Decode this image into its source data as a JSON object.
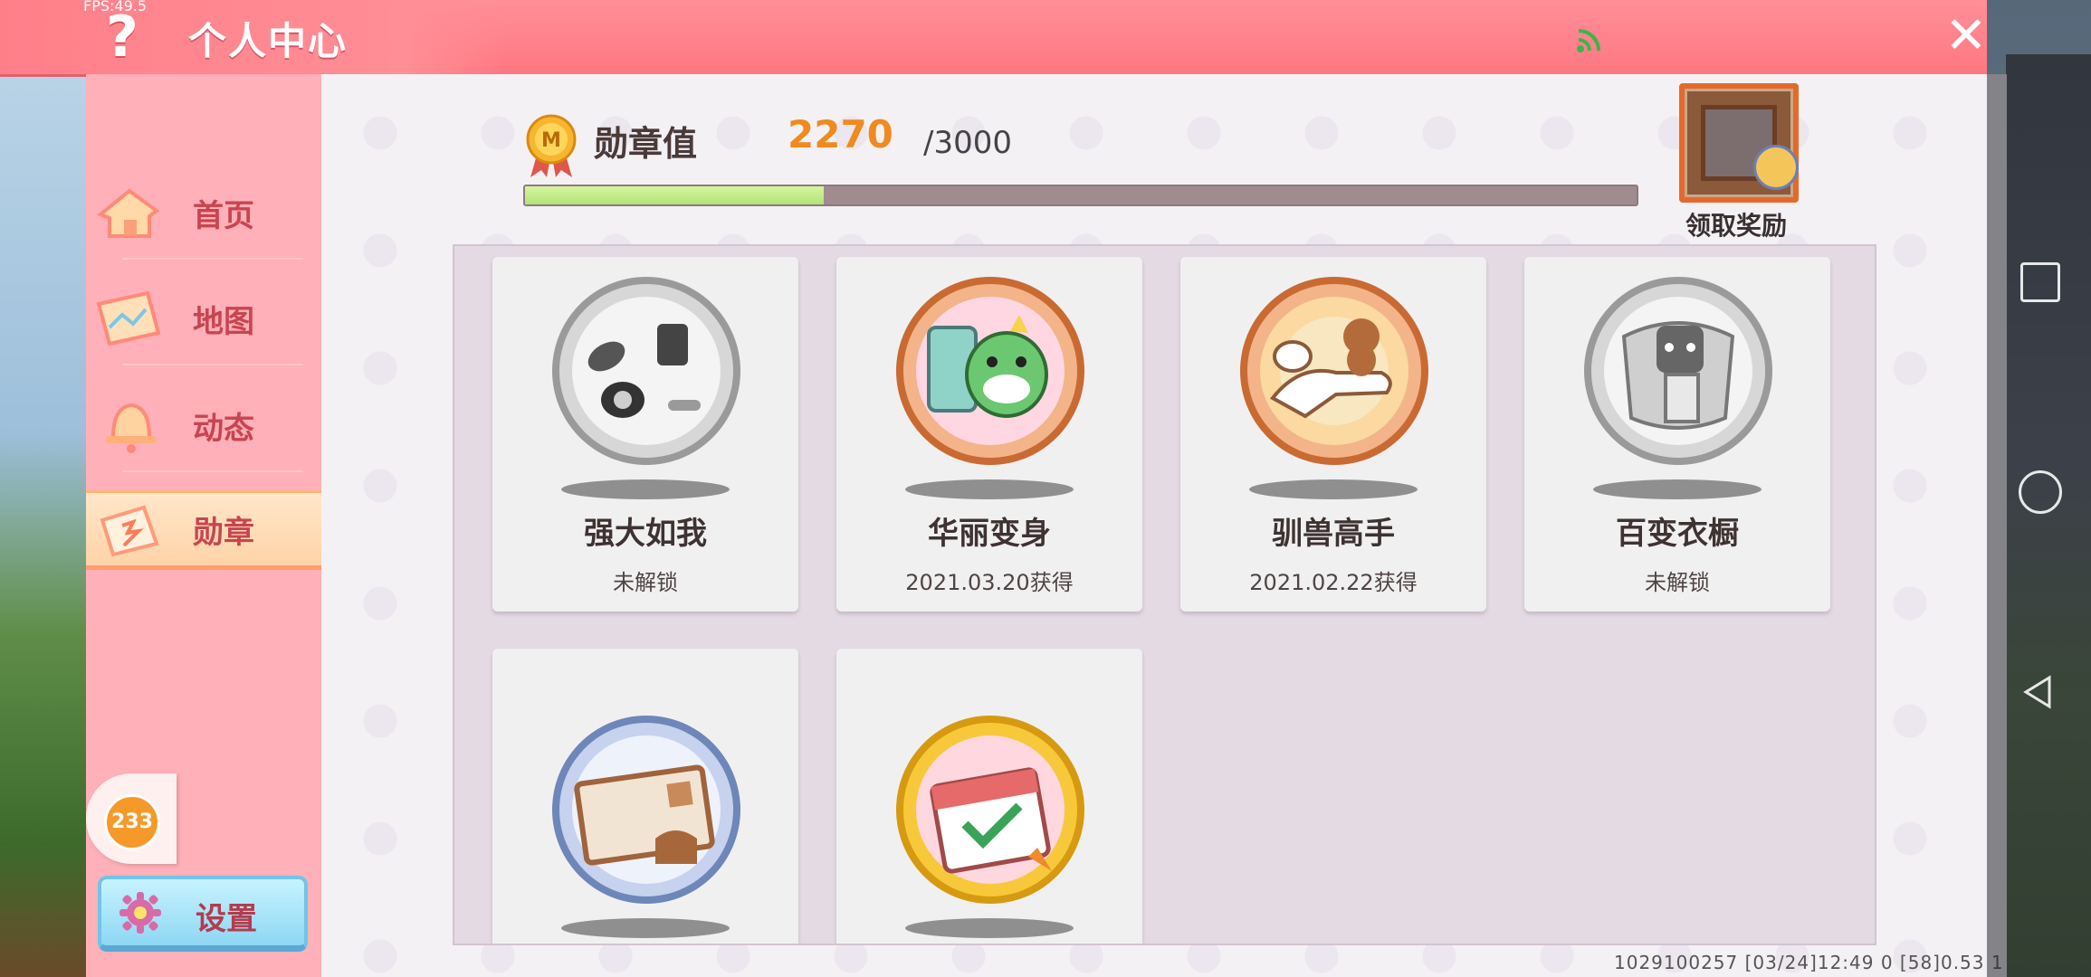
{
  "system": {
    "fps": "FPS:49.5",
    "footer": "1029100257   [03/24]12:49 0  [58]0.53 1"
  },
  "header": {
    "title": "个人中心",
    "help_symbol": "?",
    "close_symbol": "✕"
  },
  "sidebar": {
    "items": [
      {
        "label": "首页",
        "icon": "home-icon",
        "active": false
      },
      {
        "label": "地图",
        "icon": "map-icon",
        "active": false
      },
      {
        "label": "动态",
        "icon": "bell-icon",
        "active": false
      },
      {
        "label": "勋章",
        "icon": "medal-icon",
        "active": true
      }
    ],
    "badge_count": "233",
    "settings_label": "设置"
  },
  "medal_progress": {
    "label": "勋章值",
    "value": "2270",
    "max": "/3000",
    "fraction": 0.2689
  },
  "reward": {
    "label": "领取奖励"
  },
  "medals": [
    {
      "name": "强大如我",
      "status": "未解锁",
      "tier": "silver"
    },
    {
      "name": "华丽变身",
      "status": "2021.03.20获得",
      "tier": "bronze"
    },
    {
      "name": "驯兽高手",
      "status": "2021.02.22获得",
      "tier": "bronze"
    },
    {
      "name": "百变衣橱",
      "status": "未解锁",
      "tier": "silver"
    },
    {
      "name": "",
      "status": "",
      "tier": "blue"
    },
    {
      "name": "",
      "status": "",
      "tier": "gold"
    }
  ],
  "colors": {
    "header": "#ff7781",
    "sidebar": "#ffb0b8",
    "accent_value": "#f08a1e",
    "progress_fill": "#b2e37a",
    "progress_track": "#a08b8f"
  }
}
